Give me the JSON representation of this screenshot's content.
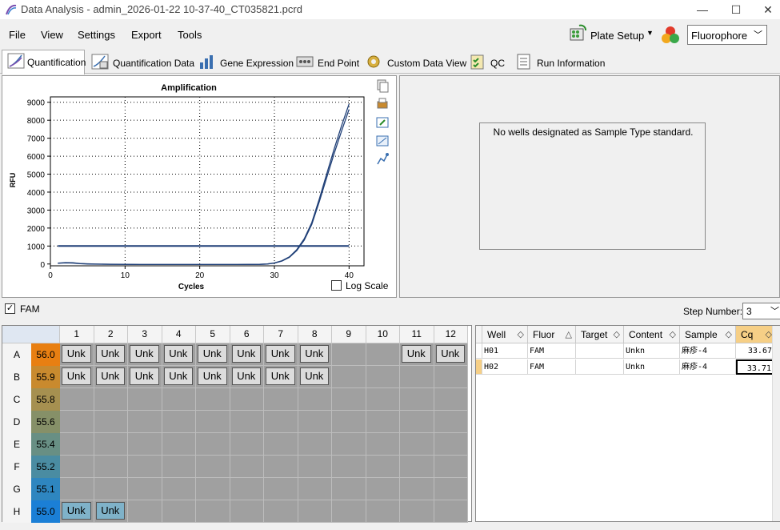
{
  "window": {
    "title": "Data Analysis - admin_2026-01-22 10-37-40_CT035821.pcrd",
    "minimize": "—",
    "maximize": "☐",
    "close": "✕"
  },
  "menu": {
    "items": [
      "File",
      "View",
      "Settings",
      "Export",
      "Tools"
    ]
  },
  "toolbar": {
    "plate_setup": "Plate Setup",
    "fluorophore": "Fluorophore"
  },
  "tabs": [
    "Quantification",
    "Quantification Data",
    "Gene Expression",
    "End Point",
    "Custom Data View",
    "QC",
    "Run Information"
  ],
  "chart_data": {
    "type": "line",
    "title": "Amplification",
    "xlabel": "Cycles",
    "ylabel": "RFU",
    "xlim": [
      0,
      42
    ],
    "ylim": [
      -100,
      9300
    ],
    "xticks": [
      0,
      10,
      20,
      30,
      40
    ],
    "yticks": [
      0,
      1000,
      2000,
      3000,
      4000,
      5000,
      6000,
      7000,
      8000,
      9000
    ],
    "threshold": 1000,
    "series": [
      {
        "x": [
          1,
          2,
          3,
          4,
          5,
          6,
          8,
          10,
          12,
          15,
          18,
          20,
          22,
          25,
          28,
          29,
          30,
          31,
          32,
          33,
          34,
          35,
          36,
          37,
          38,
          39,
          40
        ],
        "y": [
          50,
          80,
          70,
          30,
          10,
          0,
          -10,
          -20,
          -30,
          -30,
          -30,
          -30,
          -30,
          -30,
          -20,
          0,
          60,
          180,
          400,
          800,
          1400,
          2300,
          3600,
          5000,
          6400,
          7700,
          8900
        ]
      },
      {
        "x": [
          1,
          2,
          3,
          4,
          5,
          6,
          8,
          10,
          12,
          15,
          18,
          20,
          22,
          25,
          28,
          29,
          30,
          31,
          32,
          33,
          34,
          35,
          36,
          37,
          38,
          39,
          40
        ],
        "y": [
          40,
          60,
          50,
          20,
          0,
          -10,
          -20,
          -20,
          -30,
          -30,
          -30,
          -30,
          -30,
          -30,
          -20,
          0,
          50,
          160,
          370,
          750,
          1330,
          2200,
          3450,
          4800,
          6150,
          7400,
          8600
        ]
      }
    ],
    "colors": {
      "line": "#1f3f77",
      "threshold": "#1f3f77"
    },
    "grid": true
  },
  "chart_options": {
    "log_scale": "Log Scale"
  },
  "standard_panel": {
    "message": "No wells designated as Sample Type standard."
  },
  "fluor_filter": {
    "label": "FAM"
  },
  "step": {
    "label": "Step Number:",
    "value": "3"
  },
  "plate": {
    "columns": [
      "1",
      "2",
      "3",
      "4",
      "5",
      "6",
      "7",
      "8",
      "9",
      "10",
      "11",
      "12"
    ],
    "rows": [
      {
        "label": "A",
        "temp": "56.0",
        "color": "#e87f12",
        "wells": [
          "Unk",
          "Unk",
          "Unk",
          "Unk",
          "Unk",
          "Unk",
          "Unk",
          "Unk",
          "",
          "",
          "Unk",
          "Unk"
        ]
      },
      {
        "label": "B",
        "temp": "55.9",
        "color": "#c98a2e",
        "wells": [
          "Unk",
          "Unk",
          "Unk",
          "Unk",
          "Unk",
          "Unk",
          "Unk",
          "Unk",
          "",
          "",
          "",
          ""
        ]
      },
      {
        "label": "C",
        "temp": "55.8",
        "color": "#a69050",
        "wells": [
          "",
          "",
          "",
          "",
          "",
          "",
          "",
          "",
          "",
          "",
          "",
          ""
        ]
      },
      {
        "label": "D",
        "temp": "55.6",
        "color": "#869068",
        "wells": [
          "",
          "",
          "",
          "",
          "",
          "",
          "",
          "",
          "",
          "",
          "",
          ""
        ]
      },
      {
        "label": "E",
        "temp": "55.4",
        "color": "#688f84",
        "wells": [
          "",
          "",
          "",
          "",
          "",
          "",
          "",
          "",
          "",
          "",
          "",
          ""
        ]
      },
      {
        "label": "F",
        "temp": "55.2",
        "color": "#4a8ca2",
        "wells": [
          "",
          "",
          "",
          "",
          "",
          "",
          "",
          "",
          "",
          "",
          "",
          ""
        ]
      },
      {
        "label": "G",
        "temp": "55.1",
        "color": "#2e86c0",
        "wells": [
          "",
          "",
          "",
          "",
          "",
          "",
          "",
          "",
          "",
          "",
          "",
          ""
        ]
      },
      {
        "label": "H",
        "temp": "55.0",
        "color": "#1b7fd6",
        "wells": [
          "Unk",
          "Unk",
          "",
          "",
          "",
          "",
          "",
          "",
          "",
          "",
          "",
          ""
        ]
      }
    ]
  },
  "well_table": {
    "headers": [
      "Well",
      "Fluor",
      "Target",
      "Content",
      "Sample",
      "Cq"
    ],
    "rows": [
      {
        "well": "H01",
        "fluor": "FAM",
        "target": "",
        "content": "Unkn",
        "sample": "麻疹-4",
        "cq": "33.67"
      },
      {
        "well": "H02",
        "fluor": "FAM",
        "target": "",
        "content": "Unkn",
        "sample": "麻疹-4",
        "cq": "33.71"
      }
    ]
  }
}
